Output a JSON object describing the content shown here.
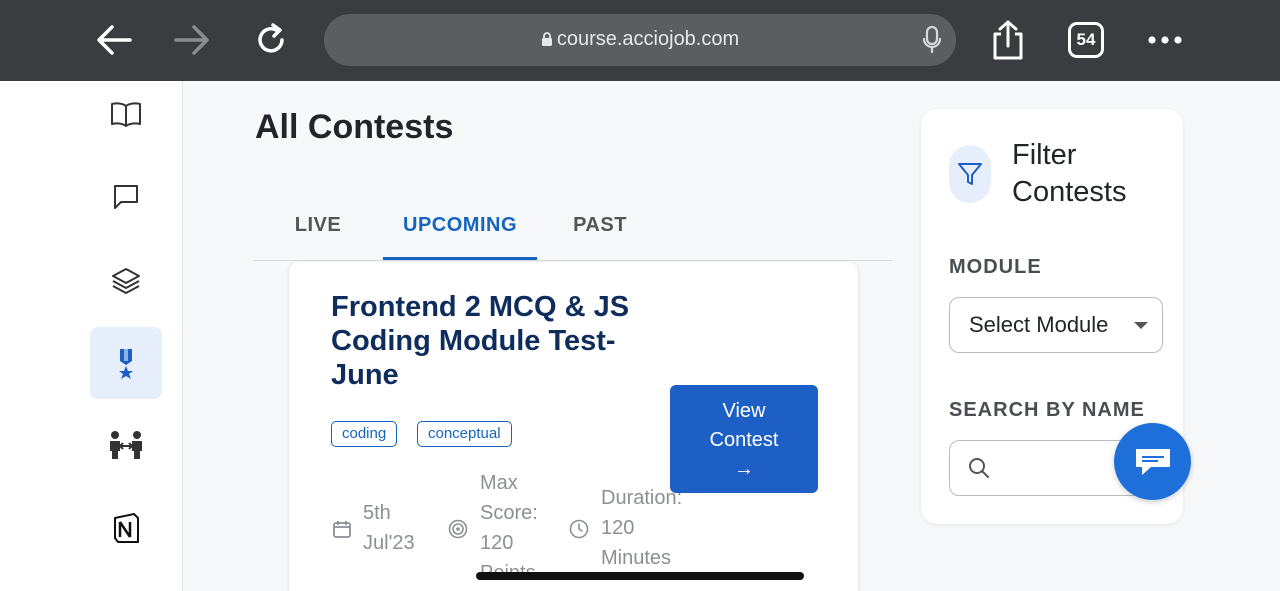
{
  "browser": {
    "url": "course.acciojob.com",
    "tab_count": "54",
    "icons": [
      "back-arrow-icon",
      "forward-arrow-icon",
      "reload-icon",
      "lock-icon",
      "mic-icon",
      "share-icon",
      "tabs-icon",
      "more-icon"
    ]
  },
  "sidebar": {
    "items": [
      {
        "icon": "book-icon",
        "active": false
      },
      {
        "icon": "chat-icon",
        "active": false
      },
      {
        "icon": "layers-icon",
        "active": false
      },
      {
        "icon": "medal-icon",
        "active": true
      },
      {
        "icon": "people-icon",
        "active": false
      },
      {
        "icon": "notion-icon",
        "active": false
      }
    ]
  },
  "main": {
    "title": "All Contests",
    "tabs": [
      {
        "label": "LIVE",
        "active": false
      },
      {
        "label": "UPCOMING",
        "active": true
      },
      {
        "label": "PAST",
        "active": false
      }
    ],
    "card": {
      "title": "Frontend 2 MCQ & JS Coding Module Test-June",
      "tags": [
        "coding",
        "conceptual"
      ],
      "button_line1": "View",
      "button_line2": "Contest",
      "button_arrow": "→",
      "date_line1": "5th",
      "date_line2": "Jul'23",
      "score_line1": "Max",
      "score_line2": "Score:",
      "score_line3": "120",
      "score_line4": "Points",
      "duration_line1": "Duration:",
      "duration_line2": "120",
      "duration_line3": "Minutes"
    }
  },
  "filter": {
    "title_line1": "Filter",
    "title_line2": "Contests",
    "module_label": "MODULE",
    "module_selected": "Select Module",
    "search_label": "SEARCH BY NAME",
    "search_value": ""
  },
  "colors": {
    "accent": "#1565c0",
    "button": "#1e5fc5",
    "card_title": "#0f2d5c",
    "browser_bar": "#3a3c3f"
  }
}
